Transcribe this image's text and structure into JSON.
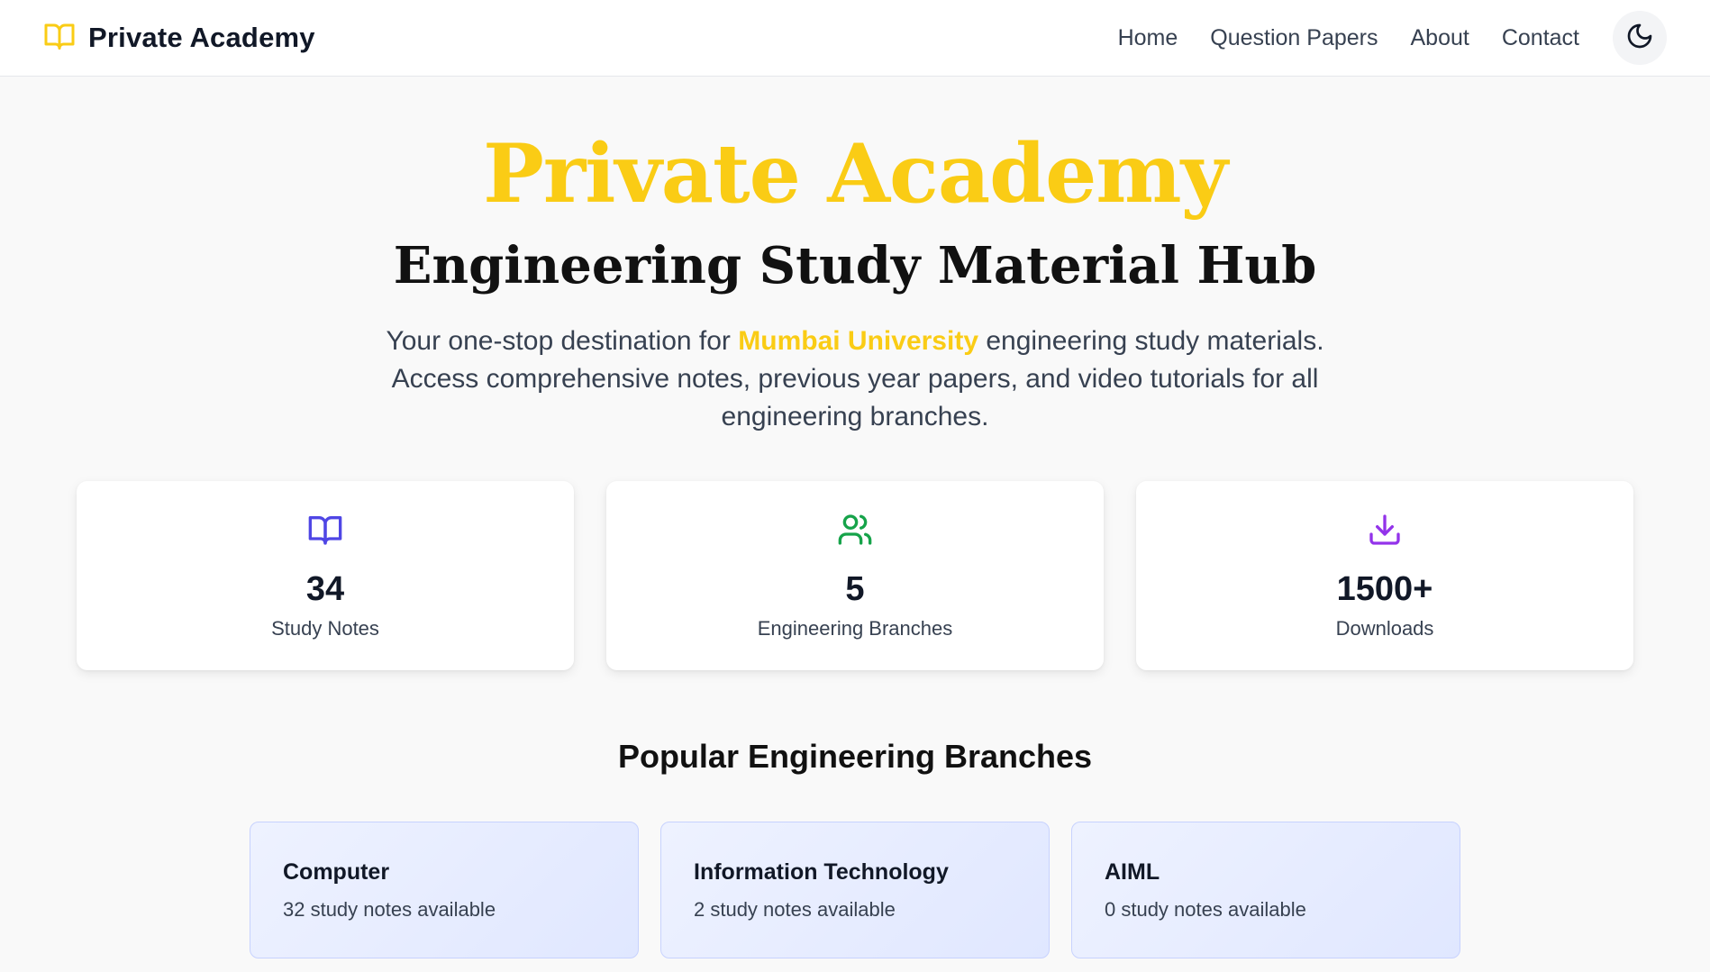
{
  "header": {
    "brand": "Private Academy",
    "nav": [
      "Home",
      "Question Papers",
      "About",
      "Contact"
    ]
  },
  "hero": {
    "title": "Private Academy",
    "subtitle": "Engineering Study Material Hub",
    "desc_prefix": "Your one-stop destination for ",
    "desc_highlight": "Mumbai University",
    "desc_suffix": " engineering study materials. Access comprehensive notes, previous year papers, and video tutorials for all engineering branches."
  },
  "stats": [
    {
      "value": "34",
      "label": "Study Notes",
      "icon": "book-open-icon",
      "color": "#4f46e5"
    },
    {
      "value": "5",
      "label": "Engineering Branches",
      "icon": "users-icon",
      "color": "#16a34a"
    },
    {
      "value": "1500+",
      "label": "Downloads",
      "icon": "download-icon",
      "color": "#9333ea"
    }
  ],
  "branches_section": {
    "title": "Popular Engineering Branches",
    "items": [
      {
        "name": "Computer",
        "count": "32 study notes available"
      },
      {
        "name": "Information Technology",
        "count": "2 study notes available"
      },
      {
        "name": "AIML",
        "count": "0 study notes available"
      }
    ]
  },
  "colors": {
    "accent": "#facc15",
    "background": "#f9f9f9",
    "card_border": "#c7d2fe"
  }
}
